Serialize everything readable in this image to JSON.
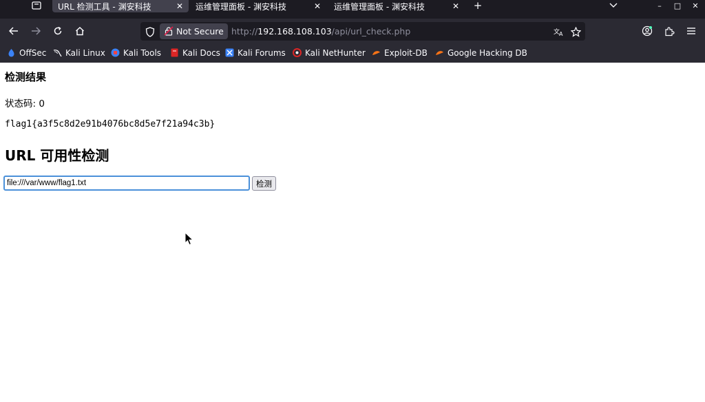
{
  "tabs": [
    {
      "title": "URL 检测工具 - 渊安科技",
      "active": true
    },
    {
      "title": "运维管理面板 - 渊安科技",
      "active": false
    },
    {
      "title": "运维管理面板 - 渊安科技",
      "active": false
    }
  ],
  "tab_close_glyph": "✕",
  "new_tab_glyph": "+",
  "window_controls": {
    "minimize": "–",
    "maximize": "□",
    "close": "✕"
  },
  "navbar": {
    "security_label": "Not Secure",
    "url": {
      "scheme": "http://",
      "host": "192.168.108.103",
      "path": "/api/url_check.php"
    }
  },
  "bookmarks": [
    {
      "label": "OffSec",
      "icon": "offsec-icon",
      "color": "#3b82f6"
    },
    {
      "label": "Kali Linux",
      "icon": "kali-dragon-icon",
      "color": "#fbfbfe"
    },
    {
      "label": "Kali Tools",
      "icon": "kali-tools-icon",
      "color": "#3b82f6"
    },
    {
      "label": "Kali Docs",
      "icon": "kali-docs-icon",
      "color": "#dc2626"
    },
    {
      "label": "Kali Forums",
      "icon": "kali-forums-icon",
      "color": "#3b82f6"
    },
    {
      "label": "Kali NetHunter",
      "icon": "nethunter-icon",
      "color": "#dc2626"
    },
    {
      "label": "Exploit-DB",
      "icon": "exploit-db-icon",
      "color": "#f97316"
    },
    {
      "label": "Google Hacking DB",
      "icon": "ghdb-icon",
      "color": "#f97316"
    }
  ],
  "page": {
    "result_title": "检测结果",
    "status_line": "状态码: 0",
    "flag_text": "flag1{a3f5c8d2e91b4076bc8d5e7f21a94c3b}",
    "check_title": "URL 可用性检测",
    "url_input_value": "file:///var/www/flag1.txt",
    "check_button_label": "检测"
  },
  "colors": {
    "accent_focus": "#4a90d9",
    "chrome_dark": "#1c1b22",
    "toolbar": "#2b2a33"
  }
}
